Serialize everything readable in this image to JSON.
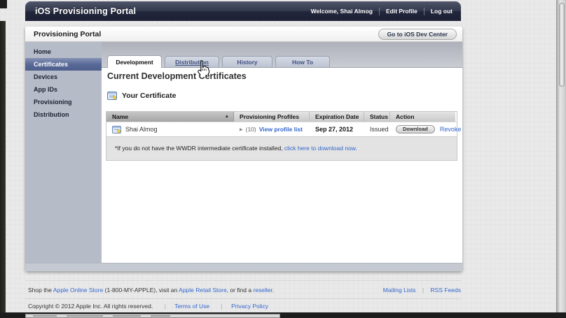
{
  "top_bar": {
    "title": "iOS Provisioning Portal",
    "welcome": "Welcome, Shai Almog",
    "edit_profile": "Edit Profile",
    "log_out": "Log out"
  },
  "portal_bar": {
    "title": "Provisioning Portal",
    "dev_center_button": "Go to iOS Dev Center"
  },
  "sidebar": {
    "items": [
      {
        "label": "Home",
        "selected": false
      },
      {
        "label": "Certificates",
        "selected": true
      },
      {
        "label": "Devices",
        "selected": false
      },
      {
        "label": "App IDs",
        "selected": false
      },
      {
        "label": "Provisioning",
        "selected": false
      },
      {
        "label": "Distribution",
        "selected": false
      }
    ]
  },
  "tabs": [
    {
      "label": "Development",
      "active": true
    },
    {
      "label": "Distribution",
      "active": false,
      "hovered": true
    },
    {
      "label": "History",
      "active": false
    },
    {
      "label": "How To",
      "active": false
    }
  ],
  "content": {
    "heading": "Current Development Certificates",
    "section_title": "Your Certificate",
    "table": {
      "columns": {
        "name": "Name",
        "profiles": "Provisioning Profiles",
        "expiration": "Expiration Date",
        "status": "Status",
        "action": "Action"
      },
      "sort_arrow": "▲",
      "row": {
        "expander": "▶",
        "name": "Shai Almog",
        "profiles_count": "(10)",
        "profiles_link": "View profile list",
        "expiration": "Sep 27, 2012",
        "status": "Issued",
        "download_button": "Download",
        "revoke_link": "Revoke"
      }
    },
    "wwdr_note": {
      "text": "*If you do not have the WWDR intermediate certificate installed, ",
      "link": "click here to download now."
    }
  },
  "footer": {
    "shop": {
      "prefix": "Shop the ",
      "online_store": "Apple Online Store",
      "mid1": " (1-800-MY-APPLE), visit an ",
      "retail_store": "Apple Retail Store",
      "mid2": ", or find a ",
      "reseller": "reseller",
      "suffix": "."
    },
    "mailing_lists": "Mailing Lists",
    "links_separator": "|",
    "rss_feeds": "RSS Feeds",
    "copyright": "Copyright © 2012 Apple Inc. All rights reserved.",
    "terms": "Terms of Use",
    "privacy": "Privacy Policy"
  },
  "colors": {
    "top_bar_dark": "#22263b",
    "link_blue": "#3366cc",
    "sidebar_bg": "#b6bbc8",
    "selected_item_blue": "#5a6a97",
    "note_bg": "#e3e3e3"
  }
}
